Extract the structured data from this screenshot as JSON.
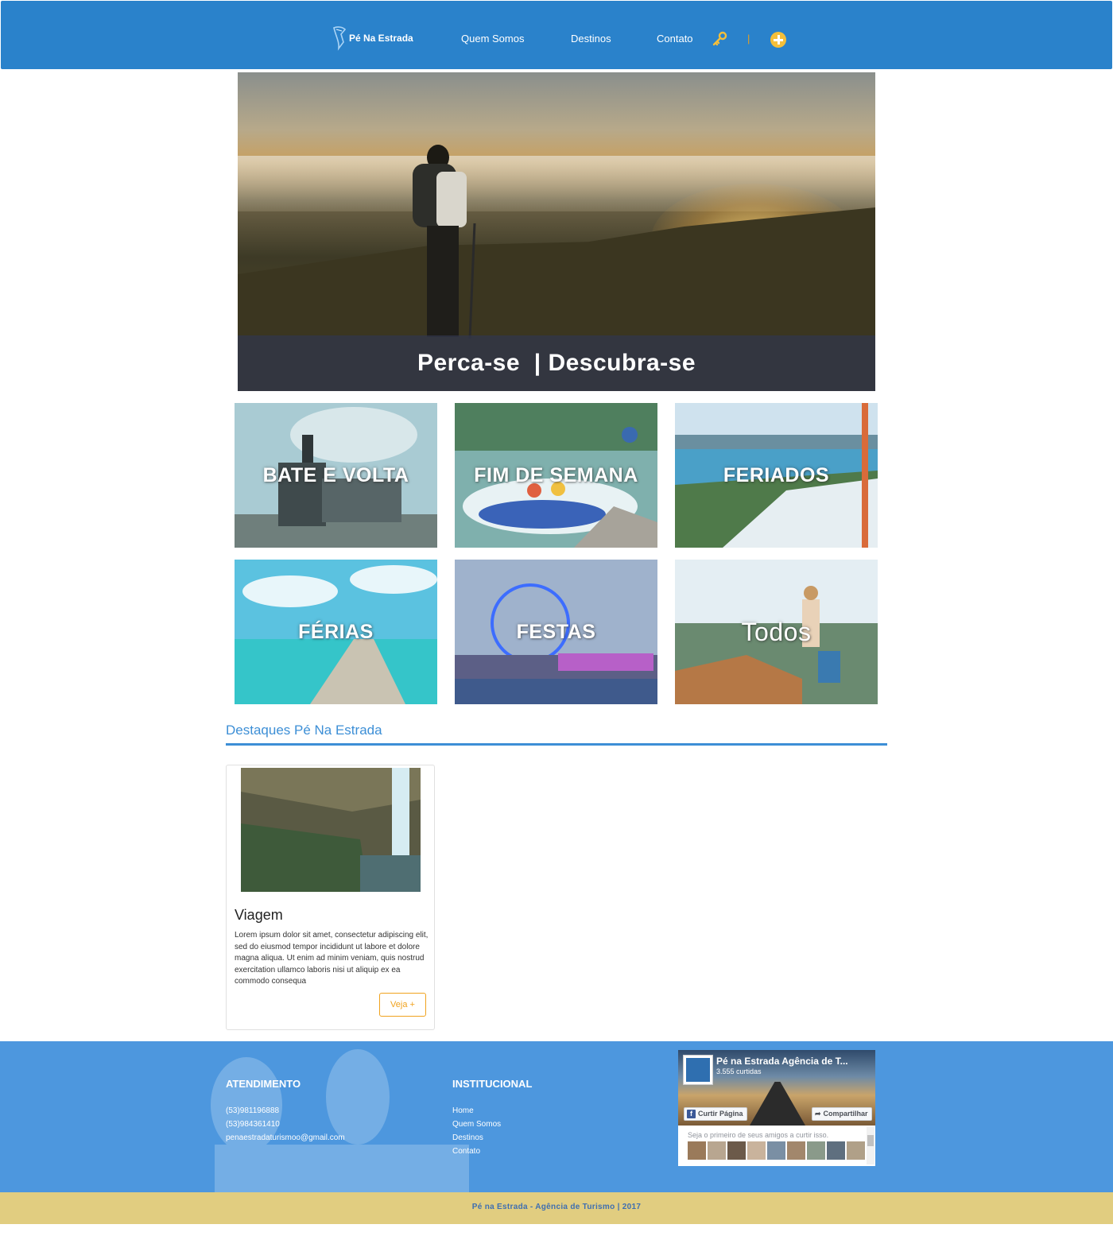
{
  "header": {
    "logo_text": "Pé Na Estrada",
    "nav": [
      "Quem Somos",
      "Destinos",
      "Contato"
    ],
    "separator": "|",
    "icons": [
      "key-icon",
      "plus-circle-icon"
    ]
  },
  "hero": {
    "caption": "Perca-se  | Descubra-se"
  },
  "categories": [
    {
      "label": "BATE E VOLTA"
    },
    {
      "label": "FIM DE SEMANA"
    },
    {
      "label": "FERIADOS"
    },
    {
      "label": "FÉRIAS"
    },
    {
      "label": "FESTAS"
    },
    {
      "label": "Todos"
    }
  ],
  "highlights": {
    "title": "Destaques Pé Na Estrada",
    "card": {
      "title": "Viagem",
      "text": "Lorem ipsum dolor sit amet, consectetur adipiscing elit, sed do eiusmod tempor incididunt ut labore et dolore magna aliqua. Ut enim ad minim veniam, quis nostrud exercitation ullamco laboris nisi ut aliquip ex ea commodo consequa",
      "button": "Veja +"
    }
  },
  "footer": {
    "atendimento": {
      "title": "ATENDIMENTO",
      "lines": [
        "(53)981196888",
        "(53)984361410",
        "penaestradaturismoo@gmail.com"
      ]
    },
    "institucional": {
      "title": "INSTITUCIONAL",
      "links": [
        "Home",
        "Quem Somos",
        "Destinos",
        "Contato"
      ]
    },
    "facebook": {
      "page_name": "Pé na Estrada Agência de T...",
      "likes": "3.555 curtidas",
      "like_button": "Curtir Página",
      "share_button": "Compartilhar",
      "friends_text": "Seja o primeiro de seus amigos a curtir isso."
    },
    "copyright": "Pé na Estrada - Agência de Turismo | 2017"
  },
  "colors": {
    "header_blue": "#2a82cb",
    "accent_blue": "#3d8fd6",
    "footer_blue": "#4d97de",
    "footer_bar": "#e1cd80",
    "button_orange": "#f0a21e"
  }
}
